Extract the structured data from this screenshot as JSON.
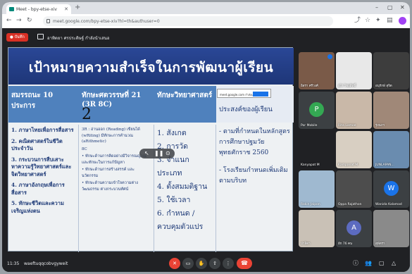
{
  "browser": {
    "tab_title": "Meet - bpy-etse-xiv",
    "url": "meet.google.com/bpy-etse-xiv?hl=th&authuser=0"
  },
  "meet": {
    "recording_label": "บันทึก",
    "presenter_label": "อาทิตยา ศรประดิษฐ์ กำลังนำเสนอ"
  },
  "slide": {
    "title": "เป้าหมายความสำเร็จในการพัฒนาผู้เรียน",
    "big_number": "2",
    "headers": [
      "สมรรถนะ 10 ประการ",
      "ทักษะศตวรรษที่ 21 (3R 8C)",
      "ทักษะวิทยาศาสตร์",
      "ประสงค์ของผู้เรียน"
    ],
    "col1": [
      "1. ภาษาไทยเพื่อการสื่อสาร",
      "2. คณิตศาสตร์ในชีวิตประจำวัน",
      "3. กระบวนการสืบเสาะหาความรู้วิทยาศาสตร์และจิตวิทยาศาสตร์",
      "4. ภาษาอังกฤษเพื่อการสื่อสาร",
      "5. ทักษะชีวิตและความเจริญแห่งตน"
    ],
    "col2": [
      "3R : อ่านออก (Reading) เขียนได้ (wRiting) มีทักษะการคำนวณ (aRithmetic)",
      "8C",
      "• ทักษะด้านการคิดอย่างมีวิจารณญาณ และทักษะในการแก้ปัญหา",
      "• ทักษะด้านการสร้างสรรค์ และนวัตกรรม",
      "• ทักษะด้านความเข้าใจความต่างวัฒนธรรม ต่างกระบวนทัศน์"
    ],
    "col3": [
      "1. สังเกต",
      "2. การวัด",
      "3. จำแนกประเภท",
      "4. ตั้งสมมติฐาน",
      "5. ใช้เวลา",
      "6. กำหนด / ควบคุมตัวแปร"
    ],
    "col4": [
      "- ตามที่กำหนดในหลักสูตรการศึกษาปฐมวัย พุทธศักราช 2560",
      "- โรงเรียนกำหนดเพิ่มเติมตามบริบท"
    ],
    "popup_text": "meet.google.com กำลังแชร์หน้าจอ"
  },
  "participants": [
    {
      "name": "อิสรา ศรีวงศ์",
      "bg": "#7a5a48",
      "avatar": "",
      "speaking": true
    },
    {
      "name": "อุไร ไชยสิทธิ์",
      "bg": "#e8e8e8",
      "avatar": "",
      "speaking": false
    },
    {
      "name": "อนุรักษ์ สุจิต",
      "bg": "#3d3d3d",
      "avatar": "",
      "speaking": false
    },
    {
      "name": "Por Mobile",
      "bg": "#3c4043",
      "avatar": "P",
      "avatar_bg": "#34a853",
      "speaking": false
    },
    {
      "name": "Rita Lamoe",
      "bg": "#c9b8a8",
      "avatar": "",
      "speaking": false
    },
    {
      "name": "รุ่งนภา",
      "bg": "#a08878",
      "avatar": "",
      "speaking": false
    },
    {
      "name": "Kanyapat M",
      "bg": "#202124",
      "avatar": "",
      "speaking": false
    },
    {
      "name": "Kampanat M",
      "bg": "#d8cfc2",
      "avatar": "",
      "speaking": false
    },
    {
      "name": "JUNLAPAN...",
      "bg": "#6a8caf",
      "avatar": "",
      "speaking": false
    },
    {
      "name": "Rakin Jaipon",
      "bg": "#9fb9d0",
      "avatar": "",
      "speaking": false
    },
    {
      "name": "Oppa Rajathon",
      "bg": "#4d4d4d",
      "avatar": "",
      "speaking": false
    },
    {
      "name": "Wanida Kalamad",
      "bg": "#3c4043",
      "avatar": "W",
      "avatar_bg": "#1a73e8",
      "speaking": false
    },
    {
      "name": "ปาลิตา",
      "bg": "#c9c1b6",
      "avatar": "",
      "speaking": false
    },
    {
      "name": "อีก 76 คน",
      "bg": "#3c4043",
      "avatar": "A",
      "avatar_bg": "#5c6bc0",
      "speaking": false
    },
    {
      "name": "สุพัตรา",
      "bg": "#8a8a8a",
      "avatar": "",
      "speaking": false
    }
  ],
  "bottom": {
    "time": "11:35",
    "meeting_code": "waeftuqqcobvgyweit",
    "others_count": "76"
  }
}
